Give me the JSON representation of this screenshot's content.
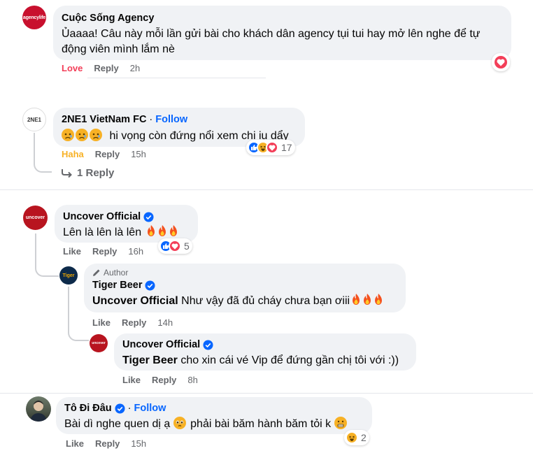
{
  "comments": [
    {
      "author": "Cuộc Sống Agency",
      "avatar_text": "agencylife",
      "text": "Ủaaaa! Câu này mỗi lần gửi bài cho khách dân agency tụi tui hay mở lên nghe để tự động viên mình lắm nè",
      "reaction_label": "Love",
      "reply_label": "Reply",
      "time": "2h"
    },
    {
      "author": "2NE1 VietNam FC",
      "avatar_text": "2NE1",
      "follow_label": "Follow",
      "text": "hi vọng còn đứng nổi xem chị iu dẩy",
      "reaction_label": "Haha",
      "reply_label": "Reply",
      "time": "15h",
      "reaction_count": "17",
      "replies_label": "1 Reply"
    },
    {
      "author": "Uncover Official",
      "avatar_text": "uncover",
      "text": "Lên là lên là lên",
      "reaction_label": "Like",
      "reply_label": "Reply",
      "time": "16h",
      "reaction_count": "5",
      "replies": [
        {
          "author_tag": "Author",
          "author": "Tiger Beer",
          "avatar_text": "Tiger",
          "mention": "Uncover Official",
          "text": "Như vậy đã đủ cháy chưa bạn ơiii",
          "reaction_label": "Like",
          "reply_label": "Reply",
          "time": "14h"
        },
        {
          "author": "Uncover Official",
          "avatar_text": "uncover",
          "mention": "Tiger Beer",
          "text": "cho xin cái vé Vip để đứng gần chị tôi với :))",
          "reaction_label": "Like",
          "reply_label": "Reply",
          "time": "8h"
        }
      ]
    },
    {
      "author": "Tô Đi Đâu",
      "follow_label": "Follow",
      "text_before": "Bài dì nghe quen dị ạ",
      "text_after": "phải bài băm hành băm tỏi k",
      "reaction_label": "Like",
      "reply_label": "Reply",
      "time": "15h",
      "reaction_count": "2"
    }
  ],
  "colors": {
    "love": "#f33e58",
    "haha": "#f7b125",
    "link": "#0866ff",
    "muted": "#65676b",
    "bubble": "#f0f2f5"
  }
}
